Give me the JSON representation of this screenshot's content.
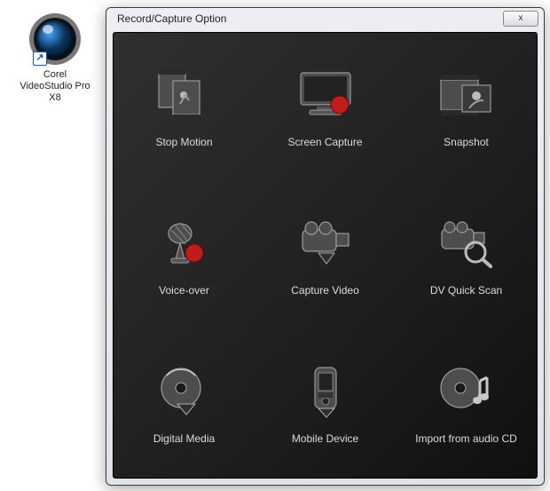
{
  "desktop": {
    "icon_label": "Corel VideoStudio Pro X8",
    "shortcut_glyph": "↗"
  },
  "dialog": {
    "title": "Record/Capture Option",
    "close_glyph": "x"
  },
  "options": [
    {
      "id": "stop-motion",
      "label": "Stop Motion"
    },
    {
      "id": "screen-capture",
      "label": "Screen Capture"
    },
    {
      "id": "snapshot",
      "label": "Snapshot"
    },
    {
      "id": "voice-over",
      "label": "Voice-over"
    },
    {
      "id": "capture-video",
      "label": "Capture Video"
    },
    {
      "id": "dv-quick-scan",
      "label": "DV Quick Scan"
    },
    {
      "id": "digital-media",
      "label": "Digital Media"
    },
    {
      "id": "mobile-device",
      "label": "Mobile Device"
    },
    {
      "id": "import-audio-cd",
      "label": "Import from audio CD"
    }
  ]
}
